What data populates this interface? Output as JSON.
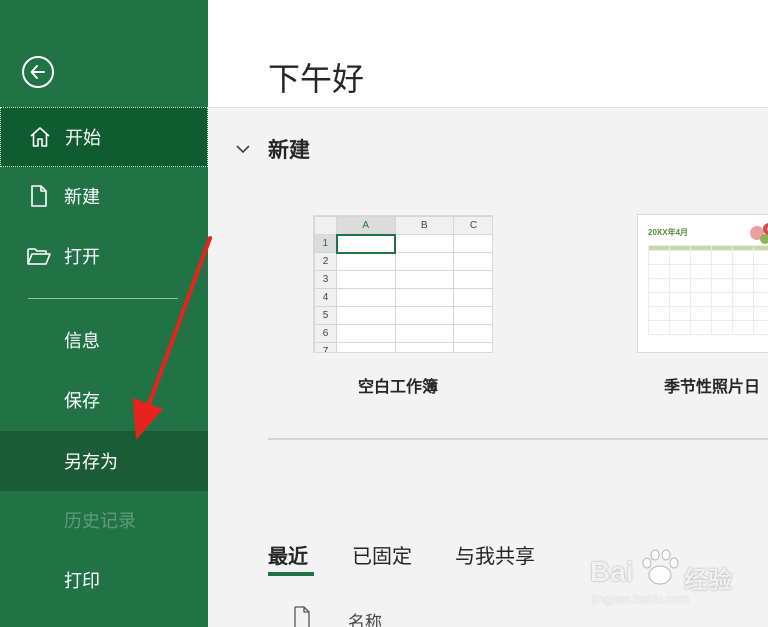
{
  "sidebar": {
    "back_icon": "back-arrow-icon",
    "items": [
      {
        "label": "开始",
        "icon": "home-icon"
      },
      {
        "label": "新建",
        "icon": "new-document-icon"
      },
      {
        "label": "打开",
        "icon": "open-folder-icon"
      },
      {
        "label": "信息"
      },
      {
        "label": "保存"
      },
      {
        "label": "另存为"
      },
      {
        "label": "历史记录"
      },
      {
        "label": "打印"
      }
    ]
  },
  "header": {
    "greeting": "下午好"
  },
  "new_section": {
    "title": "新建",
    "templates": [
      {
        "label": "空白工作簿",
        "columns": [
          "A",
          "B",
          "C"
        ],
        "rows": [
          "1",
          "2",
          "3",
          "4",
          "5",
          "6",
          "7"
        ]
      },
      {
        "label": "季节性照片日",
        "calendar_title": "20XX年4月"
      }
    ]
  },
  "recent_tabs": [
    "最近",
    "已固定",
    "与我共享"
  ],
  "file_list": {
    "name_header": "名称"
  },
  "watermark": {
    "brand": "Bai",
    "brand_cn": "经验",
    "url": "jingyan.baidu.com"
  },
  "colors": {
    "accent": "#217346",
    "active_bg": "#0e5c30",
    "arrow": "#e8231d"
  }
}
